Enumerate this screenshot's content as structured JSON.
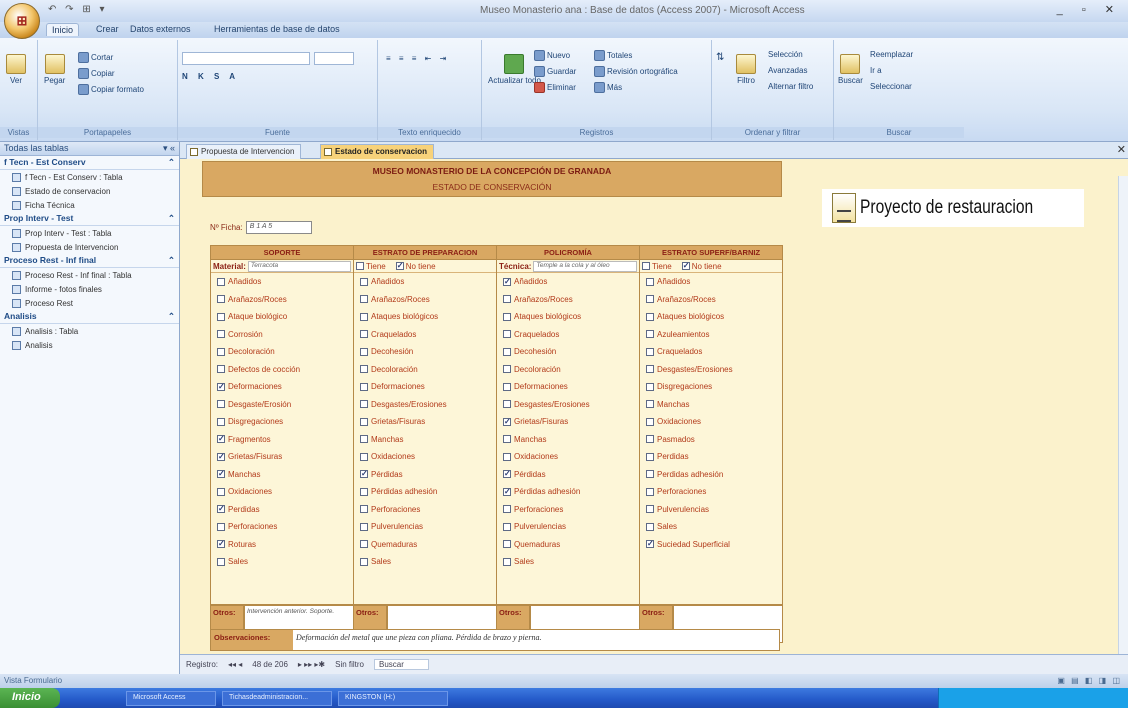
{
  "window": {
    "title": "Museo Monasterio ana : Base de datos (Access 2007) - Microsoft Access",
    "controls": "_ ▫ ✕",
    "qat": "↶ ↷ ⊞ ▾"
  },
  "ribbon_tabs": [
    "Inicio",
    "Crear",
    "Datos externos",
    "Herramientas de base de datos"
  ],
  "ribbon": {
    "groups": [
      "Vistas",
      "Portapapeles",
      "Fuente",
      "Texto enriquecido",
      "Registros",
      "Ordenar y filtrar",
      "Buscar"
    ],
    "buttons": {
      "ver": "Ver",
      "pegar": "Pegar",
      "cortar": "Cortar",
      "copiar": "Copiar",
      "copiar_formato": "Copiar formato",
      "actualizar": "Actualizar todo",
      "nuevo": "Nuevo",
      "guardar": "Guardar",
      "eliminar": "Eliminar",
      "totales": "Totales",
      "ortografia": "Revisión ortográfica",
      "mas": "Más",
      "filtro": "Filtro",
      "seleccion": "Selección",
      "avanzadas": "Avanzadas",
      "alternar_filtro": "Alternar filtro",
      "buscar": "Buscar",
      "reemplazar": "Reemplazar",
      "ir_a": "Ir a",
      "seleccionar": "Seleccionar"
    }
  },
  "nav": {
    "header": "Todas las tablas",
    "groups": [
      {
        "title": "f Tecn - Est Conserv",
        "items": [
          "f Tecn - Est Conserv : Tabla",
          "Estado de conservacion",
          "Ficha Técnica"
        ]
      },
      {
        "title": "Prop Interv - Test",
        "items": [
          "Prop Interv - Test : Tabla",
          "Propuesta de Intervencion"
        ]
      },
      {
        "title": "Proceso Rest - Inf final",
        "items": [
          "Proceso Rest - Inf final : Tabla",
          "Informe - fotos finales",
          "Proceso Rest"
        ]
      },
      {
        "title": "Analisis",
        "items": [
          "Analisis : Tabla",
          "Analisis"
        ]
      }
    ]
  },
  "doc_tabs": [
    "Propuesta de Intervencion",
    "Estado de conservacion"
  ],
  "form": {
    "title": "MUSEO MONASTERIO DE LA CONCEPCIÓN DE GRANADA",
    "subtitle": "ESTADO DE CONSERVACIÓN",
    "ficha_label": "Nº Ficha:",
    "ficha_value": "B 1 A 5",
    "columns": [
      {
        "header": "SOPORTE",
        "sub": {
          "type": "field",
          "label": "Material:",
          "value": "Terracota"
        },
        "items": [
          {
            "label": "Añadidos",
            "checked": false
          },
          {
            "label": "Arañazos/Roces",
            "checked": false
          },
          {
            "label": "Ataque biológico",
            "checked": false
          },
          {
            "label": "Corrosión",
            "checked": false
          },
          {
            "label": "Decoloración",
            "checked": false
          },
          {
            "label": "Defectos de cocción",
            "checked": false
          },
          {
            "label": "Deformaciones",
            "checked": true
          },
          {
            "label": "Desgaste/Erosión",
            "checked": false
          },
          {
            "label": "Disgregaciones",
            "checked": false
          },
          {
            "label": "Fragmentos",
            "checked": true
          },
          {
            "label": "Grietas/Fisuras",
            "checked": true
          },
          {
            "label": "Manchas",
            "checked": true
          },
          {
            "label": "Oxidaciones",
            "checked": false
          },
          {
            "label": "Perdidas",
            "checked": true
          },
          {
            "label": "Perforaciones",
            "checked": false
          },
          {
            "label": "Roturas",
            "checked": true
          },
          {
            "label": "Sales",
            "checked": false
          }
        ],
        "otros_label": "Otros:",
        "otros_value": "Intervención anterior. Soporte."
      },
      {
        "header": "ESTRATO DE PREPARACION",
        "sub": {
          "type": "tiene",
          "tiene": "Tiene",
          "tiene_checked": false,
          "no_tiene": "No tiene",
          "no_tiene_checked": true
        },
        "items": [
          {
            "label": "Añadidos",
            "checked": false
          },
          {
            "label": "Arañazos/Roces",
            "checked": false
          },
          {
            "label": "Ataques biológicos",
            "checked": false
          },
          {
            "label": "Craquelados",
            "checked": false
          },
          {
            "label": "Decohesión",
            "checked": false
          },
          {
            "label": "Decoloración",
            "checked": false
          },
          {
            "label": "Deformaciones",
            "checked": false
          },
          {
            "label": "Desgastes/Erosiones",
            "checked": false
          },
          {
            "label": "Grietas/Fisuras",
            "checked": false
          },
          {
            "label": "Manchas",
            "checked": false
          },
          {
            "label": "Oxidaciones",
            "checked": false
          },
          {
            "label": "Pérdidas",
            "checked": true
          },
          {
            "label": "Pérdidas adhesión",
            "checked": false
          },
          {
            "label": "Perforaciones",
            "checked": false
          },
          {
            "label": "Pulverulencias",
            "checked": false
          },
          {
            "label": "Quemaduras",
            "checked": false
          },
          {
            "label": "Sales",
            "checked": false
          }
        ],
        "otros_label": "Otros:",
        "otros_value": ""
      },
      {
        "header": "POLICROMÍA",
        "sub": {
          "type": "field",
          "label": "Técnica:",
          "value": "Temple a la cola y al óleo"
        },
        "items": [
          {
            "label": "Añadidos",
            "checked": true
          },
          {
            "label": "Arañazos/Roces",
            "checked": false
          },
          {
            "label": "Ataques biológicos",
            "checked": false
          },
          {
            "label": "Craquelados",
            "checked": false
          },
          {
            "label": "Decohesión",
            "checked": false
          },
          {
            "label": "Decoloración",
            "checked": false
          },
          {
            "label": "Deformaciones",
            "checked": false
          },
          {
            "label": "Desgastes/Erosiones",
            "checked": false
          },
          {
            "label": "Grietas/Fisuras",
            "checked": true
          },
          {
            "label": "Manchas",
            "checked": false
          },
          {
            "label": "Oxidaciones",
            "checked": false
          },
          {
            "label": "Pérdidas",
            "checked": true
          },
          {
            "label": "Pérdidas adhesión",
            "checked": true
          },
          {
            "label": "Perforaciones",
            "checked": false
          },
          {
            "label": "Pulverulencias",
            "checked": false
          },
          {
            "label": "Quemaduras",
            "checked": false
          },
          {
            "label": "Sales",
            "checked": false
          }
        ],
        "otros_label": "Otros:",
        "otros_value": ""
      },
      {
        "header": "ESTRATO SUPERF/BARNIZ",
        "sub": {
          "type": "tiene",
          "tiene": "Tiene",
          "tiene_checked": false,
          "no_tiene": "No tiene",
          "no_tiene_checked": true
        },
        "items": [
          {
            "label": "Añadidos",
            "checked": false
          },
          {
            "label": "Arañazos/Roces",
            "checked": false
          },
          {
            "label": "Ataques biológicos",
            "checked": false
          },
          {
            "label": "Azuleamientos",
            "checked": false
          },
          {
            "label": "Craquelados",
            "checked": false
          },
          {
            "label": "Desgastes/Erosiones",
            "checked": false
          },
          {
            "label": "Disgregaciones",
            "checked": false
          },
          {
            "label": "Manchas",
            "checked": false
          },
          {
            "label": "Oxidaciones",
            "checked": false
          },
          {
            "label": "Pasmados",
            "checked": false
          },
          {
            "label": "Perdidas",
            "checked": false
          },
          {
            "label": "Perdidas adhesión",
            "checked": false
          },
          {
            "label": "Perforaciones",
            "checked": false
          },
          {
            "label": "Pulverulencias",
            "checked": false
          },
          {
            "label": "Sales",
            "checked": false
          },
          {
            "label": "Suciedad Superficial",
            "checked": true
          }
        ],
        "otros_label": "Otros:",
        "otros_value": ""
      }
    ],
    "observaciones_label": "Observaciones:",
    "observaciones_value": "Deformación del metal que une pieza con pliana. Pérdida de brazo y pierna."
  },
  "logo_text": "Proyecto de restauracion",
  "record_nav": {
    "label": "Registro:",
    "controls": "◂◂ ◂",
    "position": "48 de 206",
    "controls_next": "▸ ▸▸ ▸✱",
    "filter": "Sin filtro",
    "search": "Buscar"
  },
  "status": {
    "left": "Vista Formulario",
    "right": "▣ ▤ ◧ ◨ ◫"
  },
  "taskbar": {
    "start": "Inicio",
    "tasks": [
      "Microsoft Access",
      "Tichasdeadministracion...",
      "KINGSTON (H:)"
    ]
  },
  "colors": {
    "accent": "#d9a862",
    "label_red": "#b23a1a",
    "form_bg": "#fbf2cc",
    "active_tab": "#f7d27a"
  }
}
